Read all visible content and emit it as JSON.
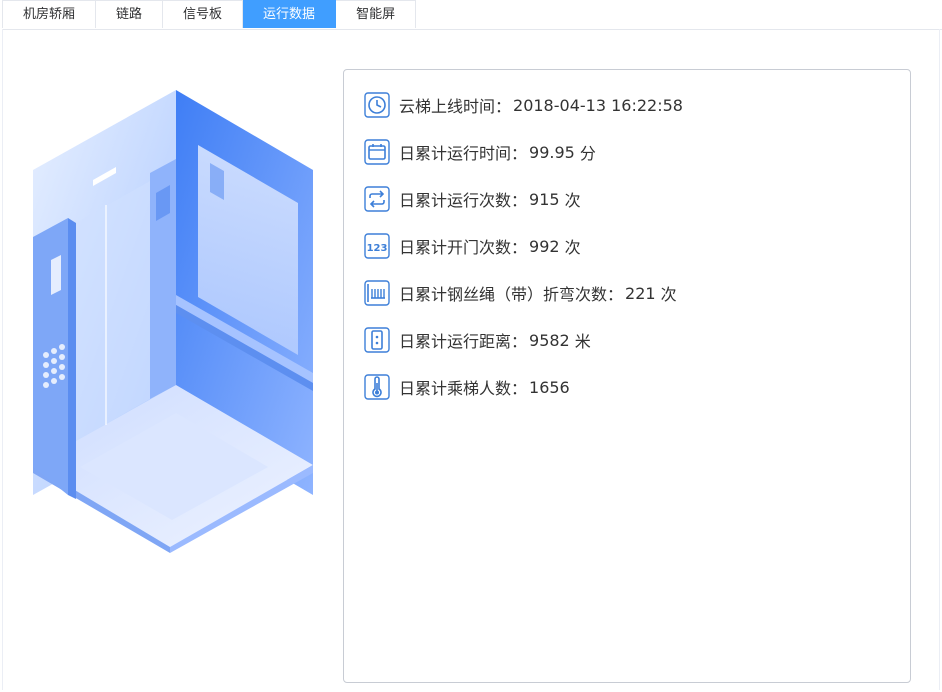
{
  "tabs": [
    {
      "label": "机房轿厢",
      "active": false
    },
    {
      "label": "链路",
      "active": false
    },
    {
      "label": "信号板",
      "active": false
    },
    {
      "label": "运行数据",
      "active": true
    },
    {
      "label": "智能屏",
      "active": false
    }
  ],
  "stats": [
    {
      "icon": "clock-icon",
      "label": "云梯上线时间：",
      "value": "2018-04-13 16:22:58",
      "unit": ""
    },
    {
      "icon": "calendar-icon",
      "label": "日累计运行时间：",
      "value": "99.95",
      "unit": "分"
    },
    {
      "icon": "repeat-icon",
      "label": "日累计运行次数：",
      "value": "915",
      "unit": "次"
    },
    {
      "icon": "number-icon",
      "label": "日累计开门次数：",
      "value": "992",
      "unit": "次"
    },
    {
      "icon": "wire-rope-icon",
      "label": "日累计钢丝绳（带）折弯次数：",
      "value": "221",
      "unit": "次"
    },
    {
      "icon": "elevator-button-icon",
      "label": "日累计运行距离：",
      "value": "9582",
      "unit": "米"
    },
    {
      "icon": "thermometer-icon",
      "label": "日累计乘梯人数：",
      "value": "1656",
      "unit": ""
    }
  ],
  "colors": {
    "accent": "#409eff",
    "icon": "#3d7fd8"
  }
}
